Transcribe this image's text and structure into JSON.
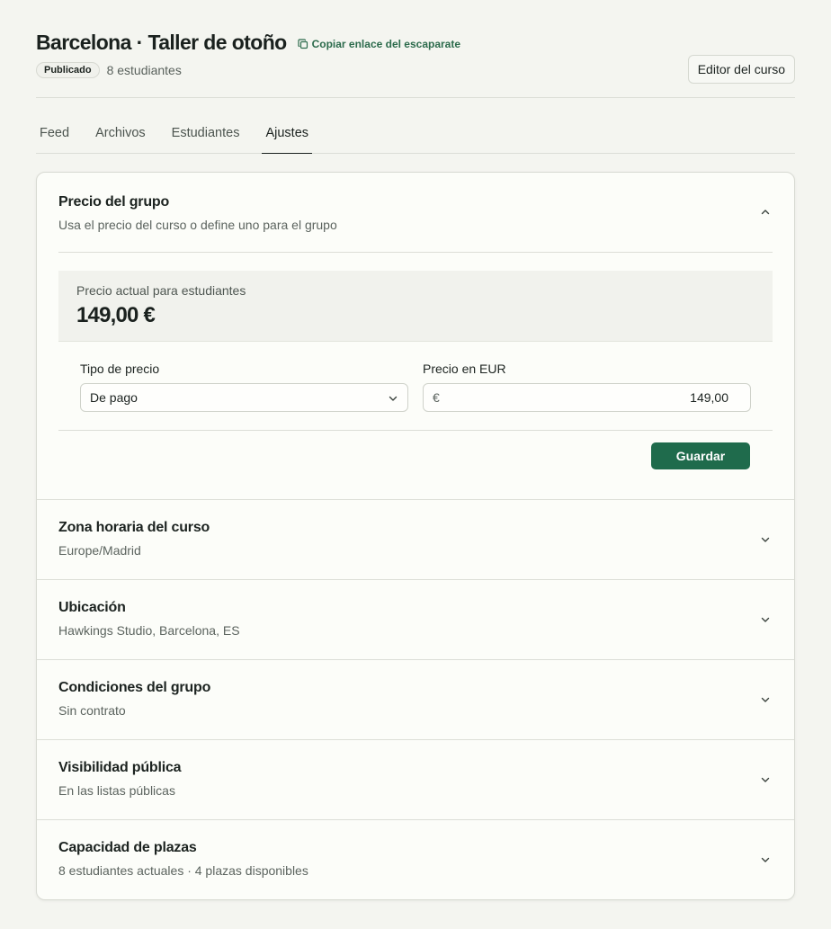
{
  "header": {
    "title": "Barcelona · Taller de otoño",
    "copy_link_label": "Copiar enlace del escaparate",
    "status_badge": "Publicado",
    "students_count": "8 estudiantes",
    "editor_button": "Editor del curso"
  },
  "tabs": [
    {
      "label": "Feed",
      "active": false
    },
    {
      "label": "Archivos",
      "active": false
    },
    {
      "label": "Estudiantes",
      "active": false
    },
    {
      "label": "Ajustes",
      "active": true
    }
  ],
  "price_section": {
    "title": "Precio del grupo",
    "subtitle": "Usa el precio del curso o define uno para el grupo",
    "current_label": "Precio actual para estudiantes",
    "current_value": "149,00 €",
    "price_type_label": "Tipo de precio",
    "price_type_value": "De pago",
    "price_amount_label": "Precio en EUR",
    "currency_symbol": "€",
    "price_amount_value": "149,00",
    "save_label": "Guardar"
  },
  "sections": [
    {
      "title": "Zona horaria del curso",
      "subtitle": "Europe/Madrid"
    },
    {
      "title": "Ubicación",
      "subtitle": "Hawkings Studio, Barcelona, ES"
    },
    {
      "title": "Condiciones del grupo",
      "subtitle": "Sin contrato"
    },
    {
      "title": "Visibilidad pública",
      "subtitle": "En las listas públicas"
    },
    {
      "title": "Capacidad de plazas",
      "subtitle": "8 estudiantes actuales · 4 plazas disponibles"
    }
  ],
  "colors": {
    "accent": "#1f6b4c",
    "link": "#2c6b4c",
    "background": "#f4f5f0",
    "card": "#fcfdf9"
  },
  "icons": {
    "copy": "copy-icon",
    "chevron_up": "chevron-up-icon",
    "chevron_down": "chevron-down-icon"
  }
}
